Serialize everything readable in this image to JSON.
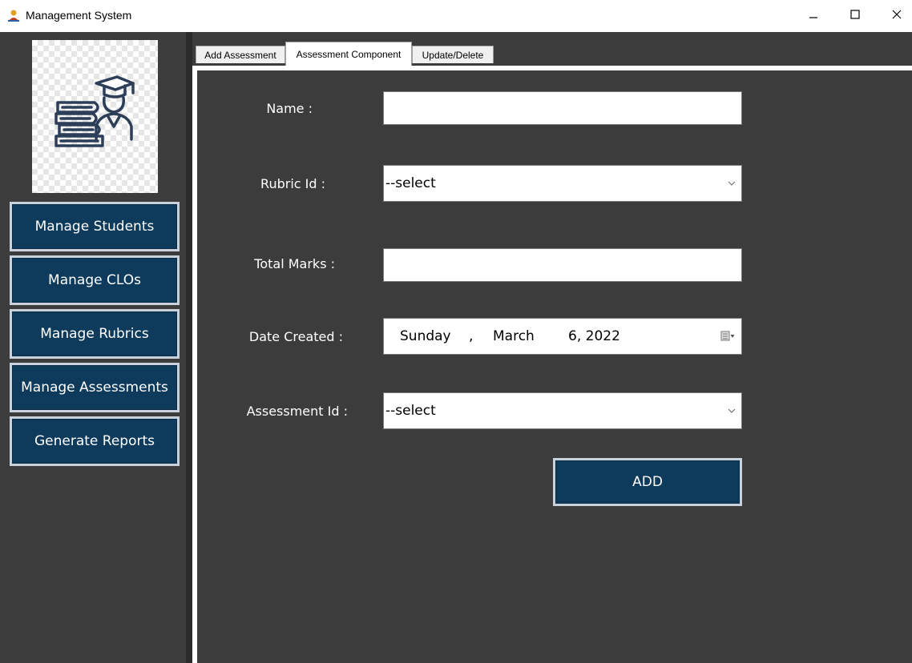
{
  "window": {
    "title": "Management System",
    "minimize_glyph": "–",
    "maximize_glyph": "☐",
    "close_glyph": "✕"
  },
  "sidebar": {
    "logo_icon": "student-books-graduation-cap-icon",
    "items": [
      {
        "label": "Manage Students"
      },
      {
        "label": "Manage CLOs"
      },
      {
        "label": "Manage Rubrics"
      },
      {
        "label": "Manage Assessments"
      },
      {
        "label": "Generate Reports"
      }
    ]
  },
  "tabs": [
    {
      "label": "Add Assessment",
      "active": false
    },
    {
      "label": "Assessment Component",
      "active": true
    },
    {
      "label": "Update/Delete",
      "active": false
    }
  ],
  "form": {
    "name": {
      "label": "Name :",
      "value": ""
    },
    "rubric_id": {
      "label": "Rubric Id :",
      "value": "--select"
    },
    "total_marks": {
      "label": "Total Marks :",
      "value": ""
    },
    "date_created": {
      "label": "Date Created :",
      "weekday": "Sunday",
      "sep1": ",",
      "month": "March",
      "day_year": "6, 2022"
    },
    "assessment_id": {
      "label": "Assessment Id :",
      "value": "--select"
    },
    "add_button": "ADD"
  },
  "colors": {
    "background_dark": "#3c3c3c",
    "button_navy": "#0e3a5c",
    "button_border": "#c9d2dc"
  }
}
